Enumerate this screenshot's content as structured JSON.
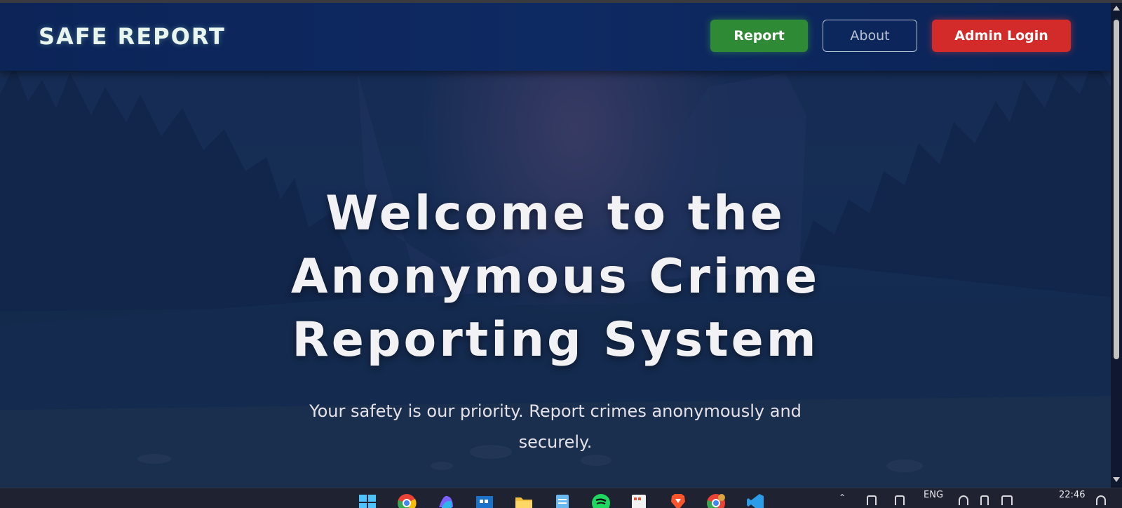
{
  "navbar": {
    "brand": "SAFE REPORT",
    "report_label": "Report",
    "about_label": "About",
    "admin_login_label": "Admin Login"
  },
  "hero": {
    "title_line1": "Welcome to the",
    "title_line2": "Anonymous Crime",
    "title_line3": "Reporting System",
    "subtitle_line1": "Your safety is our priority. Report crimes anonymously and",
    "subtitle_line2": "securely."
  },
  "colors": {
    "navbar_bg": "#0e2a62",
    "report_button": "#2f8a35",
    "admin_button": "#d32a2a",
    "about_border": "#b6c2d2"
  },
  "taskbar": {
    "icons": [
      "start-icon",
      "chrome-icon",
      "copilot-icon",
      "store-icon",
      "file-explorer-icon",
      "notepad-icon",
      "spotify-icon",
      "snipping-tool-icon",
      "brave-icon",
      "chrome-profile-icon",
      "vscode-icon"
    ],
    "language": "ENG",
    "time": "22:46"
  }
}
